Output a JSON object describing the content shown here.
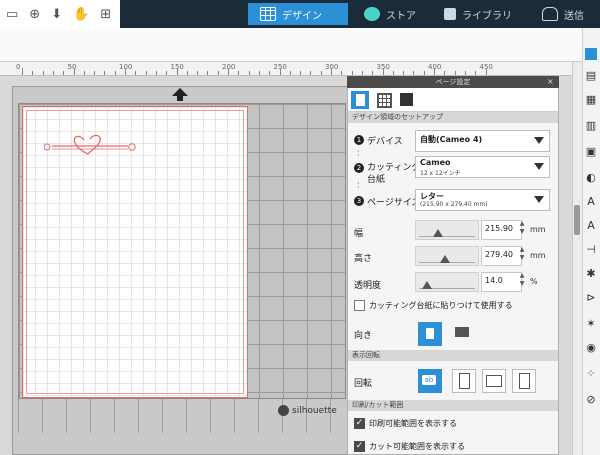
{
  "top_tabs": [
    {
      "label": "デザイン",
      "icon": "design-grid-icon",
      "active": true
    },
    {
      "label": "ストア",
      "icon": "store-icon",
      "active": false
    },
    {
      "label": "ライブラリ",
      "icon": "library-download-icon",
      "active": false
    },
    {
      "label": "送信",
      "icon": "send-icon",
      "active": false
    }
  ],
  "quick_icons": [
    "document-icon",
    "zoom-icon",
    "download-icon",
    "hand-icon",
    "add-page-icon"
  ],
  "ruler": {
    "labels": [
      "0",
      "50",
      "100",
      "150",
      "200",
      "250",
      "300",
      "350",
      "400",
      "450"
    ]
  },
  "mat": {
    "brand": "silhouette"
  },
  "panel": {
    "title": "ページ設定",
    "close": "×",
    "section_setup": "デザイン領域のセットアップ",
    "device": {
      "num": "1",
      "label": "デバイス",
      "value": "自動(Cameo 4)"
    },
    "mat": {
      "num": "2",
      "label_line1": "カッティング用",
      "label_line2": "台紙",
      "value": "Cameo",
      "sub": "12 x 12インチ"
    },
    "page_size": {
      "num": "3",
      "label": "ページサイズ",
      "value": "レター",
      "sub": "(215.90 x 279.40 mm)"
    },
    "width": {
      "label": "幅",
      "value": "215.90",
      "unit": "mm"
    },
    "height": {
      "label": "高さ",
      "value": "279.40",
      "unit": "mm"
    },
    "transparency": {
      "label": "透明度",
      "value": "14.0",
      "unit": "%"
    },
    "stick_to_mat": {
      "label": "カッティング台紙に貼りつけて使用する",
      "checked": false
    },
    "orientation": {
      "label": "向き"
    },
    "section_display_rotation": "表示回転",
    "rotation": {
      "label": "回転"
    },
    "section_print_cut": "印刷/カット範囲",
    "show_print_area": {
      "label": "印刷可能範囲を表示する",
      "checked": true
    },
    "show_cut_area": {
      "label": "カット可能範囲を表示する",
      "checked": true
    }
  },
  "right_tools": [
    "page-settings-icon",
    "print-cut-icon",
    "grid-icon",
    "fill-icon",
    "line-icon",
    "text-icon",
    "font-icon",
    "transform-icon",
    "replicate-icon",
    "modify-icon",
    "offset-icon",
    "trace-icon",
    "sketch-icon",
    "pixscan-icon",
    "library-icon"
  ],
  "colors": {
    "accent": "#2c90d6",
    "topbar": "#1c2b3a",
    "mat_border": "#e46a6a"
  }
}
